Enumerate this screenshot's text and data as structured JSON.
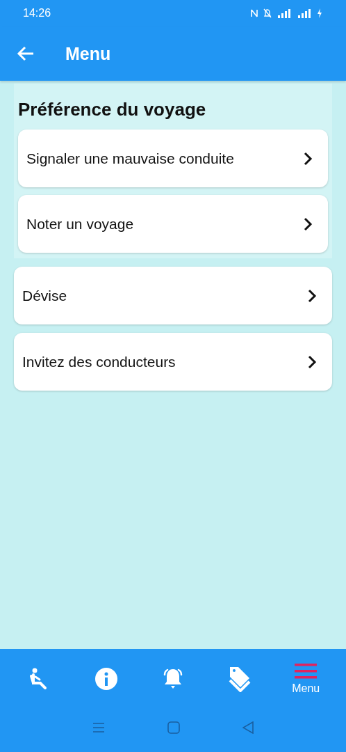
{
  "status_bar": {
    "time": "14:26"
  },
  "app_bar": {
    "title": "Menu"
  },
  "section": {
    "title": "Préférence du voyage",
    "items": [
      {
        "label": "Signaler une mauvaise conduite"
      },
      {
        "label": "Noter un voyage"
      }
    ]
  },
  "items": [
    {
      "label": "Dévise"
    },
    {
      "label": "Invitez des conducteurs"
    }
  ],
  "bottom_nav": [
    {
      "kind": "seat",
      "selected": false
    },
    {
      "kind": "info",
      "selected": false
    },
    {
      "kind": "bell",
      "selected": false
    },
    {
      "kind": "tags",
      "selected": false
    },
    {
      "kind": "menu",
      "label": "Menu",
      "selected": true
    }
  ]
}
